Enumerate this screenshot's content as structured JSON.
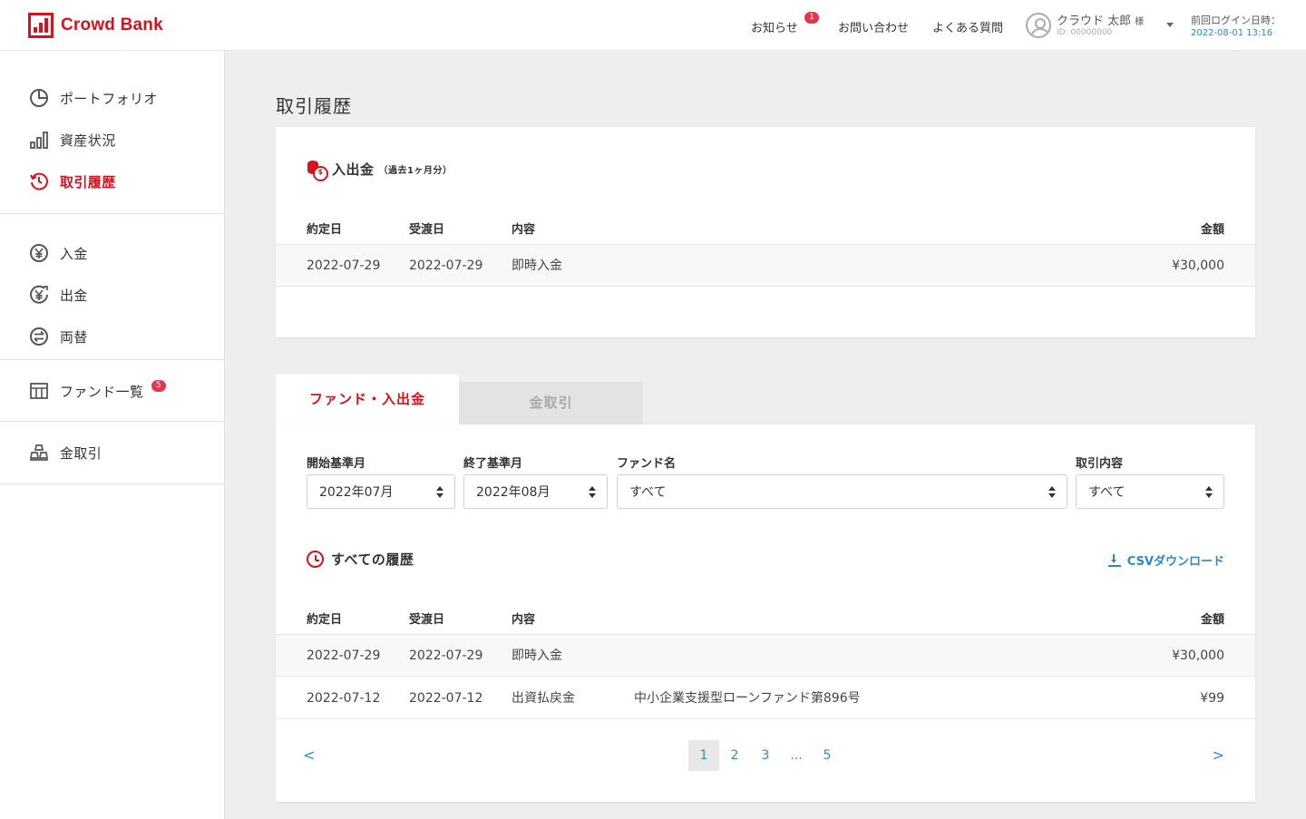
{
  "brand": {
    "name": "Crowd Bank"
  },
  "header": {
    "news": "お知らせ",
    "news_badge": "1",
    "contact": "お問い合わせ",
    "faq": "よくある質問",
    "user_name": "クラウド 太郎",
    "user_suffix": "様",
    "user_id": "ID: 00000000",
    "last_login_label": "前回ログイン日時：",
    "last_login_time": "2022-08-01 13:16"
  },
  "sidebar": {
    "items": [
      {
        "label": "ポートフォリオ",
        "icon": "pie-chart-icon"
      },
      {
        "label": "資産状況",
        "icon": "bar-chart-icon"
      },
      {
        "label": "取引履歴",
        "icon": "history-icon",
        "active": true
      },
      {
        "label": "入金",
        "icon": "yen-in-icon"
      },
      {
        "label": "出金",
        "icon": "yen-out-icon"
      },
      {
        "label": "両替",
        "icon": "exchange-icon"
      },
      {
        "label": "ファンド一覧",
        "icon": "fund-list-icon",
        "badge": "5"
      },
      {
        "label": "金取引",
        "icon": "gold-bars-icon"
      }
    ]
  },
  "main": {
    "title": "取引履歴",
    "deposit_section": {
      "title": "入出金",
      "subtitle": "（過去1ヶ月分）",
      "columns": [
        "約定日",
        "受渡日",
        "内容",
        "金額"
      ],
      "rows": [
        {
          "trade_date": "2022-07-29",
          "settlement_date": "2022-07-29",
          "content": "即時入金",
          "amount": "¥30,000"
        }
      ]
    },
    "tabs": [
      {
        "label": "ファンド・入出金",
        "active": true
      },
      {
        "label": "金取引",
        "active": false
      }
    ],
    "filters": {
      "start_month": {
        "label": "開始基準月",
        "value": "2022年07月"
      },
      "end_month": {
        "label": "終了基準月",
        "value": "2022年08月"
      },
      "fund_name": {
        "label": "ファンド名",
        "value": "すべて"
      },
      "transaction_type": {
        "label": "取引内容",
        "value": "すべて"
      }
    },
    "history_section": {
      "title": "すべての履歴",
      "csv_download": "CSVダウンロード",
      "columns": [
        "約定日",
        "受渡日",
        "内容",
        "金額"
      ],
      "rows": [
        {
          "trade_date": "2022-07-29",
          "settlement_date": "2022-07-29",
          "content": "即時入金",
          "detail": "",
          "amount": "¥30,000"
        },
        {
          "trade_date": "2022-07-12",
          "settlement_date": "2022-07-12",
          "content": "出資払戻金",
          "detail": "中小企業支援型ローンファンド第896号",
          "amount": "¥99"
        }
      ]
    },
    "pagination": {
      "prev": "<",
      "next": ">",
      "pages": [
        "1",
        "2",
        "3",
        "...",
        "5"
      ],
      "current": "1"
    }
  },
  "colors": {
    "brand_red": "#d8111e",
    "link_blue": "#2f89c6",
    "badge_red": "#e8334a",
    "background_gray": "#eeeeee"
  }
}
